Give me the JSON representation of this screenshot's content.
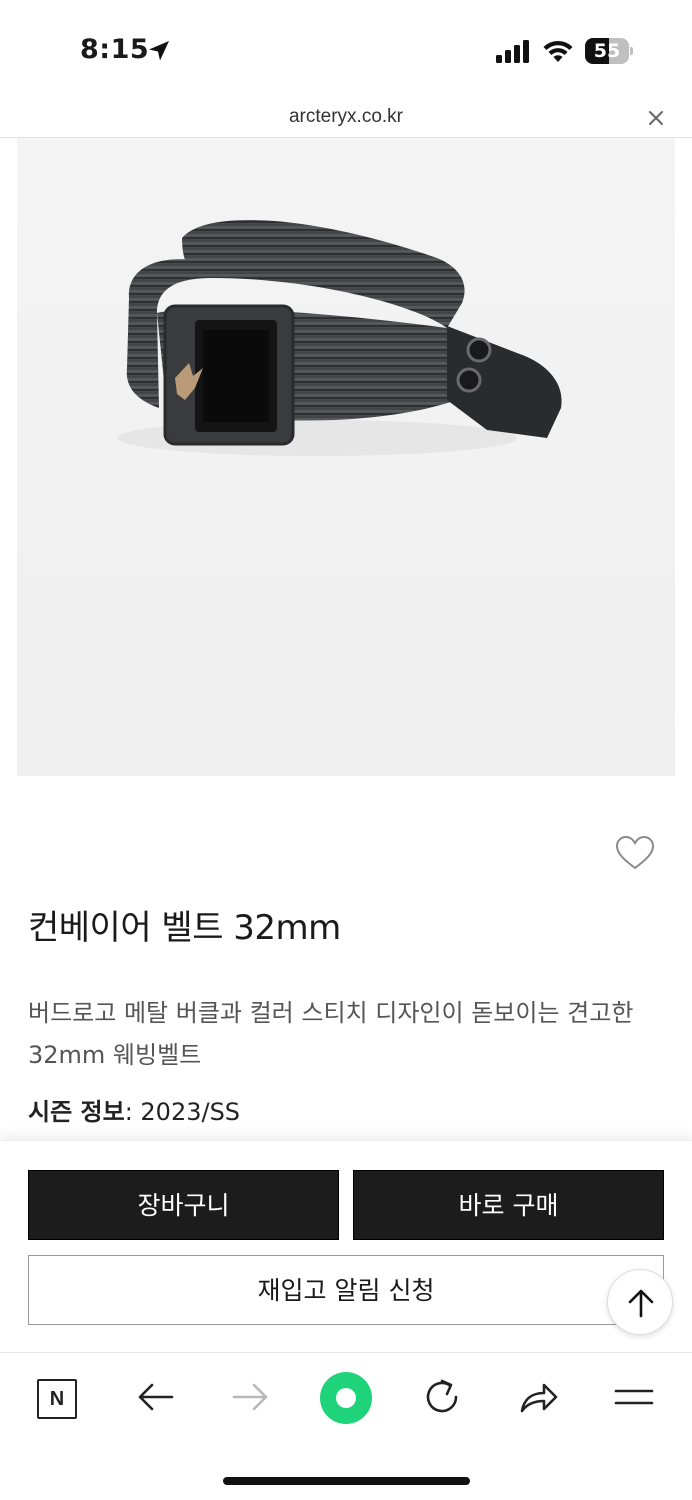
{
  "status_bar": {
    "time": "8:15",
    "battery_level": "55",
    "battery_fraction": 0.55
  },
  "url_bar": {
    "url": "arcteryx.co.kr"
  },
  "product": {
    "image_icon": "belt-product-image",
    "title": "컨베이어 벨트 32mm",
    "description": "버드로고 메탈 버클과 컬러 스티치 디자인이 돋보이는 견고한 32mm 웨빙벨트",
    "season_label": "시즌 정보",
    "season_value": ": 2023/SS"
  },
  "actions": {
    "cart": "장바구니",
    "buy_now": "바로 구매",
    "restock_alert": "재입고 알림 신청"
  },
  "toolbar": {
    "n_label": "N",
    "icons": [
      "n-home-icon",
      "back-arrow-icon",
      "forward-arrow-icon",
      "green-dot-icon",
      "reload-icon",
      "share-icon",
      "menu-icon"
    ]
  },
  "colors": {
    "accent_green": "#1ed37a",
    "button_dark": "#1c1c1c"
  }
}
